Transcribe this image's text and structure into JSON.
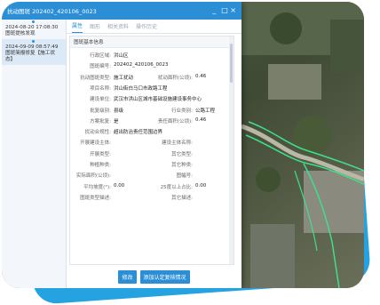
{
  "window": {
    "title": "抗动图斑 202402_420106_0023",
    "minimize_label": "_",
    "close_label": "□ ×"
  },
  "history": [
    {
      "time": "2024-08-20 17:08:30",
      "status": "图斑提核发现"
    },
    {
      "time": "2024-09-09 08:57:49",
      "status": "图斑简报修复【施工状态】"
    }
  ],
  "tabs": [
    "属性",
    "图形",
    "相关资料",
    "操作历史"
  ],
  "panel": {
    "section_title": "图斑基本信息",
    "rows": [
      {
        "label1": "行政区域:",
        "value1": "洪山区",
        "label2": "",
        "value2": ""
      },
      {
        "label1": "图斑编号:",
        "value1": "202402_420106_0023",
        "label2": "",
        "value2": ""
      },
      {
        "label1": "抗动图斑类型:",
        "value1": "施工扰动",
        "label2": "扰动面积(公顷):",
        "value2": "0.46"
      },
      {
        "label1": "项目名称:",
        "value1": "洪山街白马口市政路工程",
        "label2": "",
        "value2": ""
      },
      {
        "label1": "建设单位:",
        "value1": "武汉市洪山区城市基础设施建设事务中心",
        "label2": "",
        "value2": ""
      },
      {
        "label1": "批复级别:",
        "value1": "县级",
        "label2": "行业类别:",
        "value2": "公路工程"
      },
      {
        "label1": "方案批复:",
        "value1": "是",
        "label2": "责任面积(公顷):",
        "value2": "0.46"
      },
      {
        "label1": "扰动合规性:",
        "value1": "超出防治责任范围边界",
        "label2": "",
        "value2": ""
      },
      {
        "label1": "开展建设主体:",
        "value1": "",
        "label2": "建设主体名称:",
        "value2": ""
      },
      {
        "label1": "开展类型:",
        "value1": "",
        "label2": "其它类型:",
        "value2": ""
      },
      {
        "label1": "种植种类:",
        "value1": "",
        "label2": "其它种类:",
        "value2": ""
      },
      {
        "label1": "实际面积(公顷):",
        "value1": "",
        "label2": "图幅号:",
        "value2": ""
      },
      {
        "label1": "平均坡度(°):",
        "value1": "0.00",
        "label2": "25度以上占比:",
        "value2": "0.00"
      },
      {
        "label1": "图斑类型描述:",
        "value1": "",
        "label2": "其它描述:",
        "value2": ""
      },
      {
        "label1": "",
        "value1": "",
        "label2": "",
        "value2": ""
      }
    ]
  },
  "buttons": {
    "edit": "修改",
    "add_check": "添加认定复核情况"
  }
}
